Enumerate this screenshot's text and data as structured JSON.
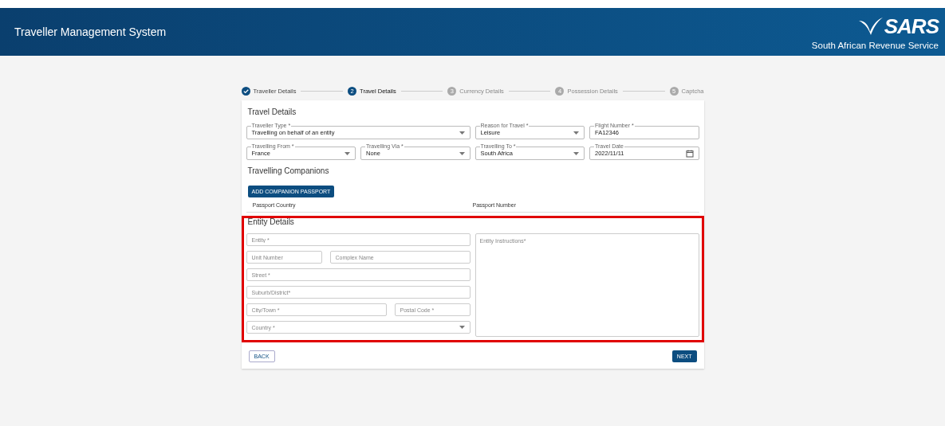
{
  "header": {
    "title": "Traveller Management System",
    "logo_text": "SARS",
    "org_name": "South African Revenue Service"
  },
  "steps": [
    {
      "label": "Traveller Details",
      "completed": true,
      "selected": false
    },
    {
      "number": "2",
      "label": "Travel Details",
      "completed": false,
      "selected": true
    },
    {
      "number": "3",
      "label": "Currency Details",
      "completed": false,
      "selected": false
    },
    {
      "number": "4",
      "label": "Possession Details",
      "completed": false,
      "selected": false
    },
    {
      "number": "5",
      "label": "Captcha",
      "completed": false,
      "selected": false
    }
  ],
  "travel_details": {
    "title": "Travel Details",
    "fields": [
      {
        "label": "Traveller Type *",
        "value": "Travelling on behalf of an entity",
        "kind": "select"
      },
      {
        "label": "Reason for Travel *",
        "value": "Leisure",
        "kind": "select"
      },
      {
        "label": "Flight Number *",
        "value": "FA12346",
        "kind": "text"
      },
      {
        "label": "Travelling From *",
        "value": "France",
        "kind": "select"
      },
      {
        "label": "Travelling Via *",
        "value": "None",
        "kind": "select"
      },
      {
        "label": "Travelling To *",
        "value": "South Africa",
        "kind": "select"
      },
      {
        "label": "Travel Date",
        "value": "2022/11/11",
        "kind": "date"
      }
    ]
  },
  "companions": {
    "title": "Travelling Companions",
    "button": "ADD COMPANION PASSPORT",
    "columns": [
      "Passport Country",
      "Passport Number"
    ]
  },
  "entity_details": {
    "title": "Entity Details",
    "highlighted": true,
    "fields": [
      {
        "placeholder": "Entity *",
        "kind": "text"
      },
      {
        "placeholder": "Unit Number",
        "kind": "text"
      },
      {
        "placeholder": "Complex Name",
        "kind": "text"
      },
      {
        "placeholder": "Street *",
        "kind": "text"
      },
      {
        "placeholder": "Suburb/District*",
        "kind": "text"
      },
      {
        "placeholder": "City/Town *",
        "kind": "text"
      },
      {
        "placeholder": "Postal Code *",
        "kind": "text"
      },
      {
        "placeholder": "Country *",
        "kind": "select"
      }
    ],
    "instructions": {
      "placeholder": "Entity Instructions*"
    }
  },
  "buttons": {
    "back": "BACK",
    "next": "NEXT"
  }
}
